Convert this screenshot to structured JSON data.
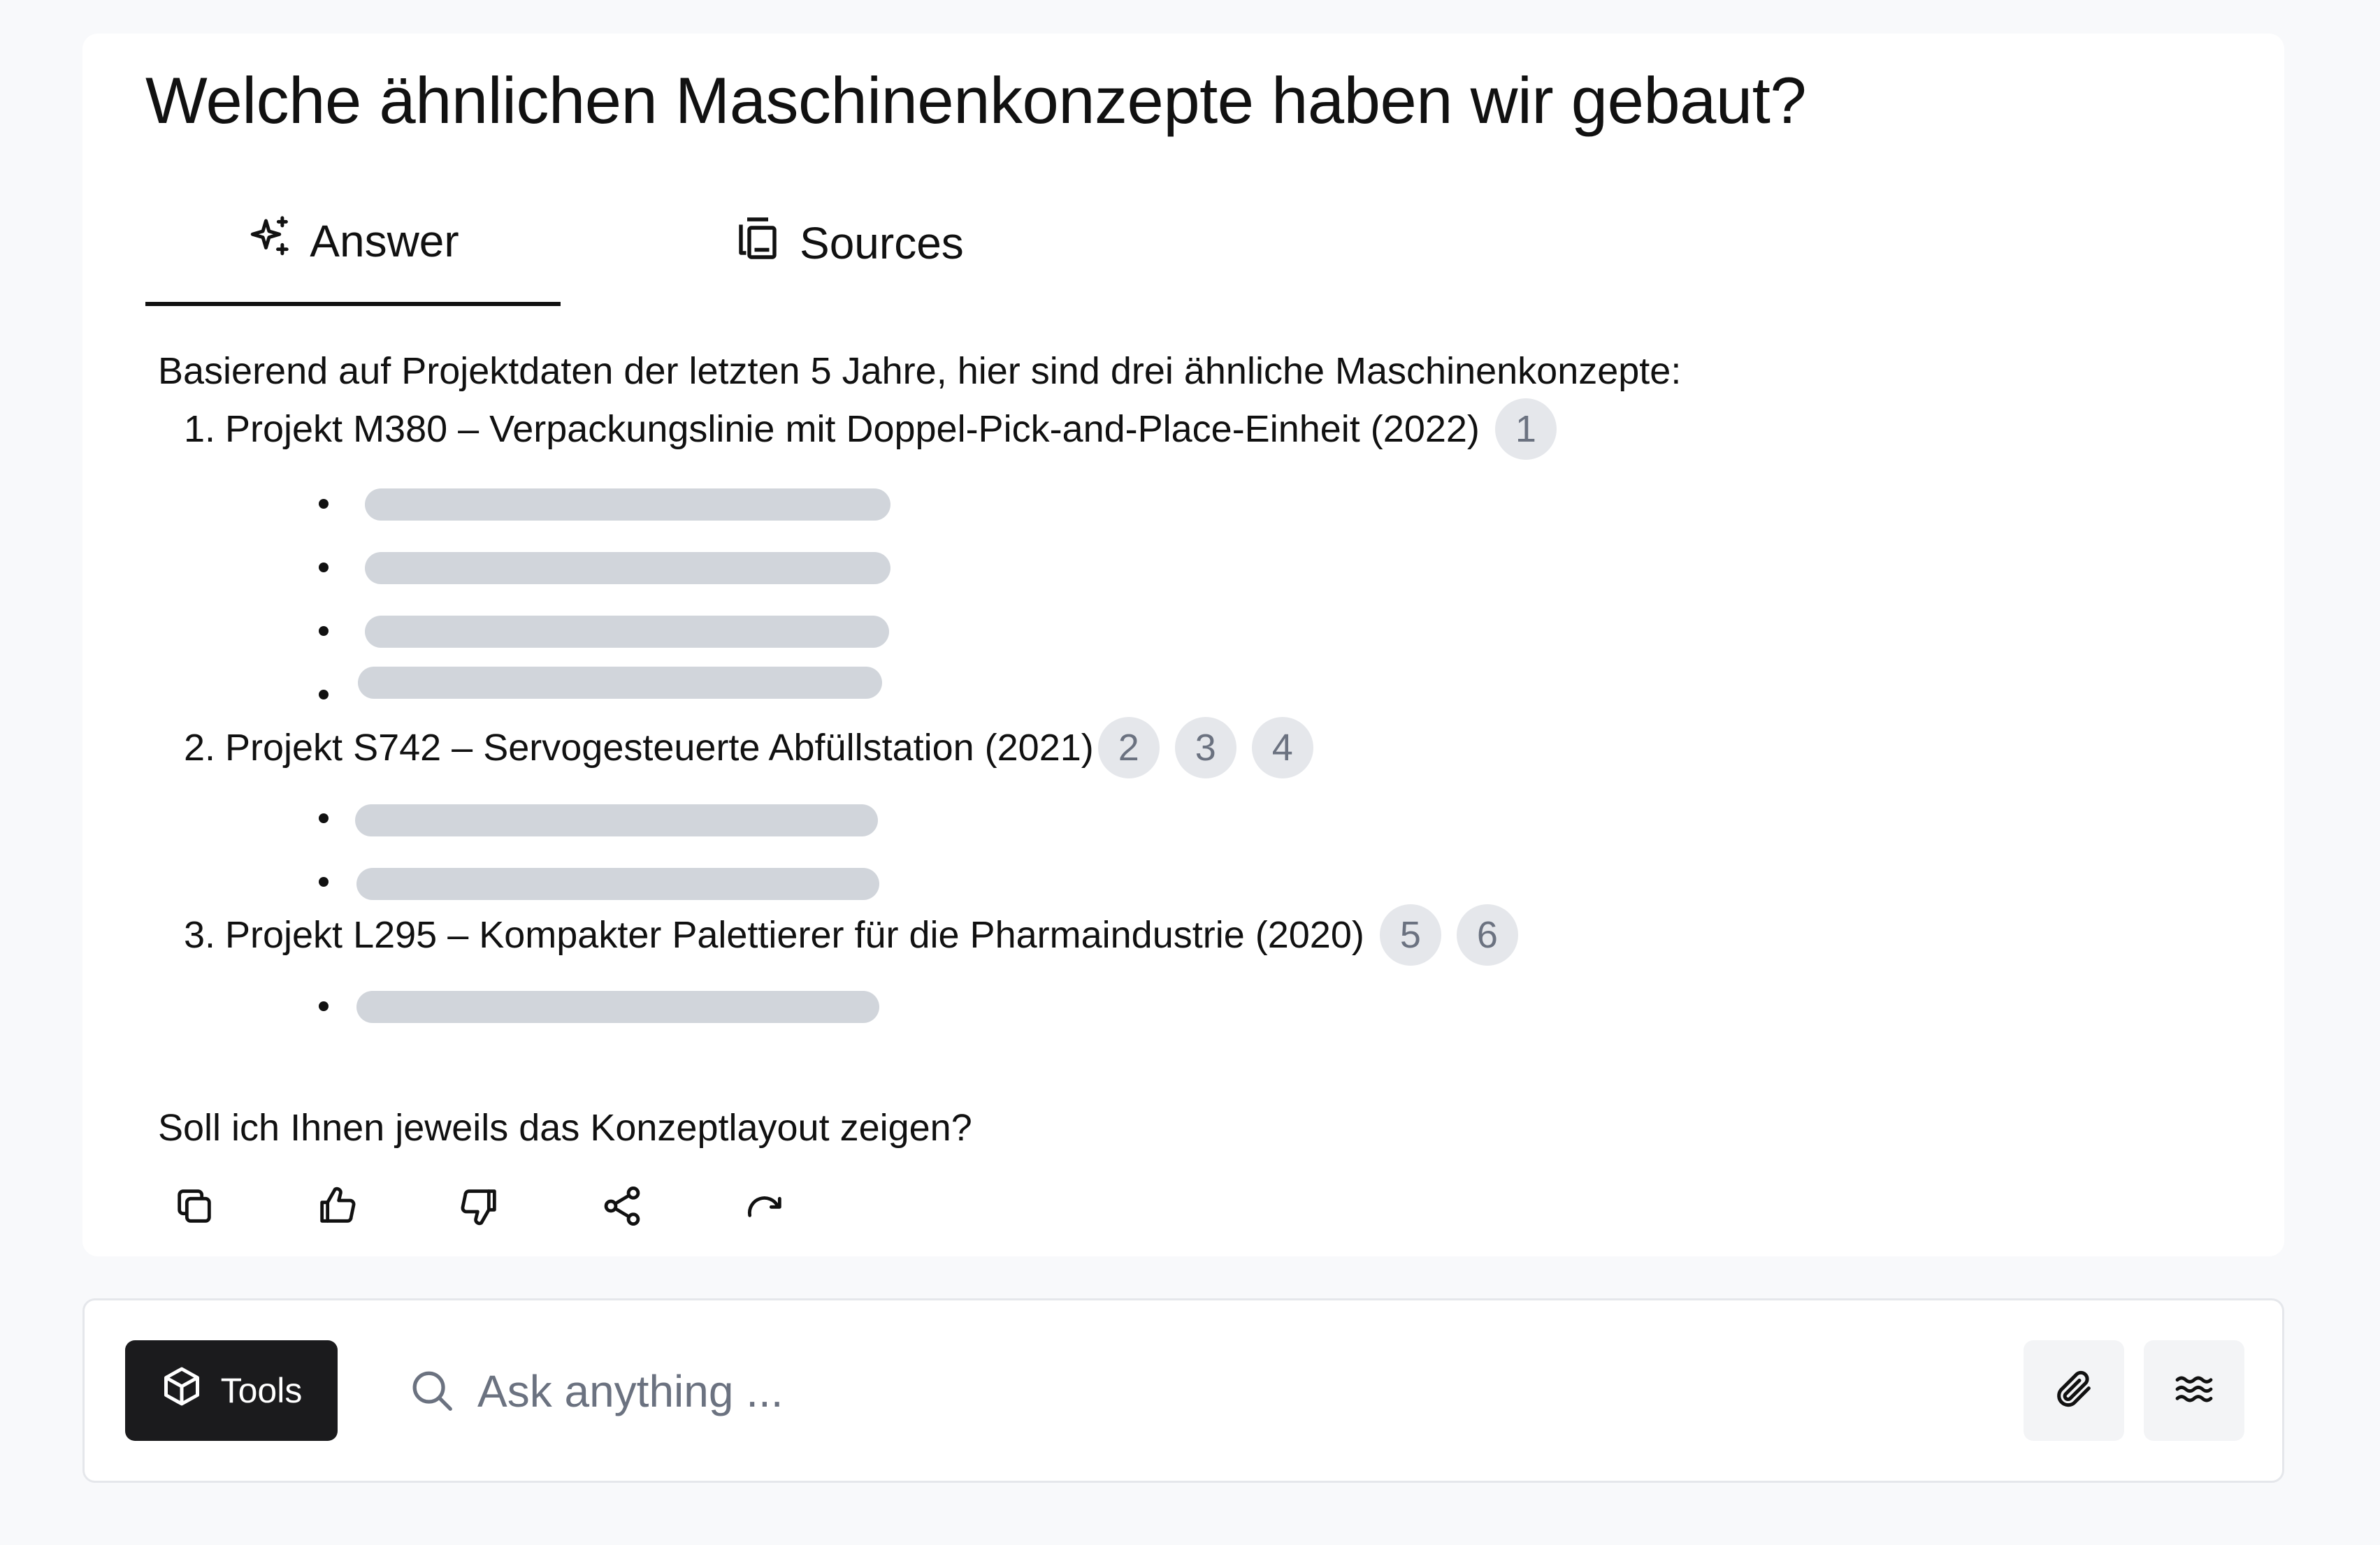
{
  "question": "Welche ähnlichen Maschinenkonzepte haben wir gebaut?",
  "tabs": [
    {
      "label": "Answer",
      "icon": "sparkles-icon",
      "active": true
    },
    {
      "label": "Sources",
      "icon": "sources-icon",
      "active": false
    }
  ],
  "answer": {
    "intro": "Basierend auf Projektdaten der letzten 5 Jahre, hier sind drei ähnliche Maschinenkonzepte:",
    "items": [
      {
        "number": "1.",
        "title": "Projekt M380 – Verpackungslinie mit Doppel-Pick-and-Place-Einheit (2022)",
        "citations": [
          "1"
        ],
        "placeholder_bullets": 4
      },
      {
        "number": "2.",
        "title": "Projekt S742 – Servogesteuerte Abfüllstation (2021)",
        "citations": [
          "2",
          "3",
          "4"
        ],
        "placeholder_bullets": 2
      },
      {
        "number": "3.",
        "title": "Projekt L295 – Kompakter Palettierer für die Pharmaindustrie (2020)",
        "citations": [
          "5",
          "6"
        ],
        "placeholder_bullets": 1
      }
    ],
    "outro": "Soll ich Ihnen jeweils das Konzeptlayout zeigen?"
  },
  "actions": [
    "copy-icon",
    "thumbs-up-icon",
    "thumbs-down-icon",
    "share-icon",
    "redo-icon"
  ],
  "composer": {
    "tools_label": "Tools",
    "tools_icon": "cube-icon",
    "placeholder": "Ask anything ...",
    "buttons": [
      "paperclip-icon",
      "waves-icon"
    ]
  },
  "colors": {
    "background": "#f8f9fb",
    "card": "#ffffff",
    "citation_badge": "#e5e7eb",
    "placeholder_bar": "#d1d5db",
    "tools_button": "#1b1b1d"
  }
}
